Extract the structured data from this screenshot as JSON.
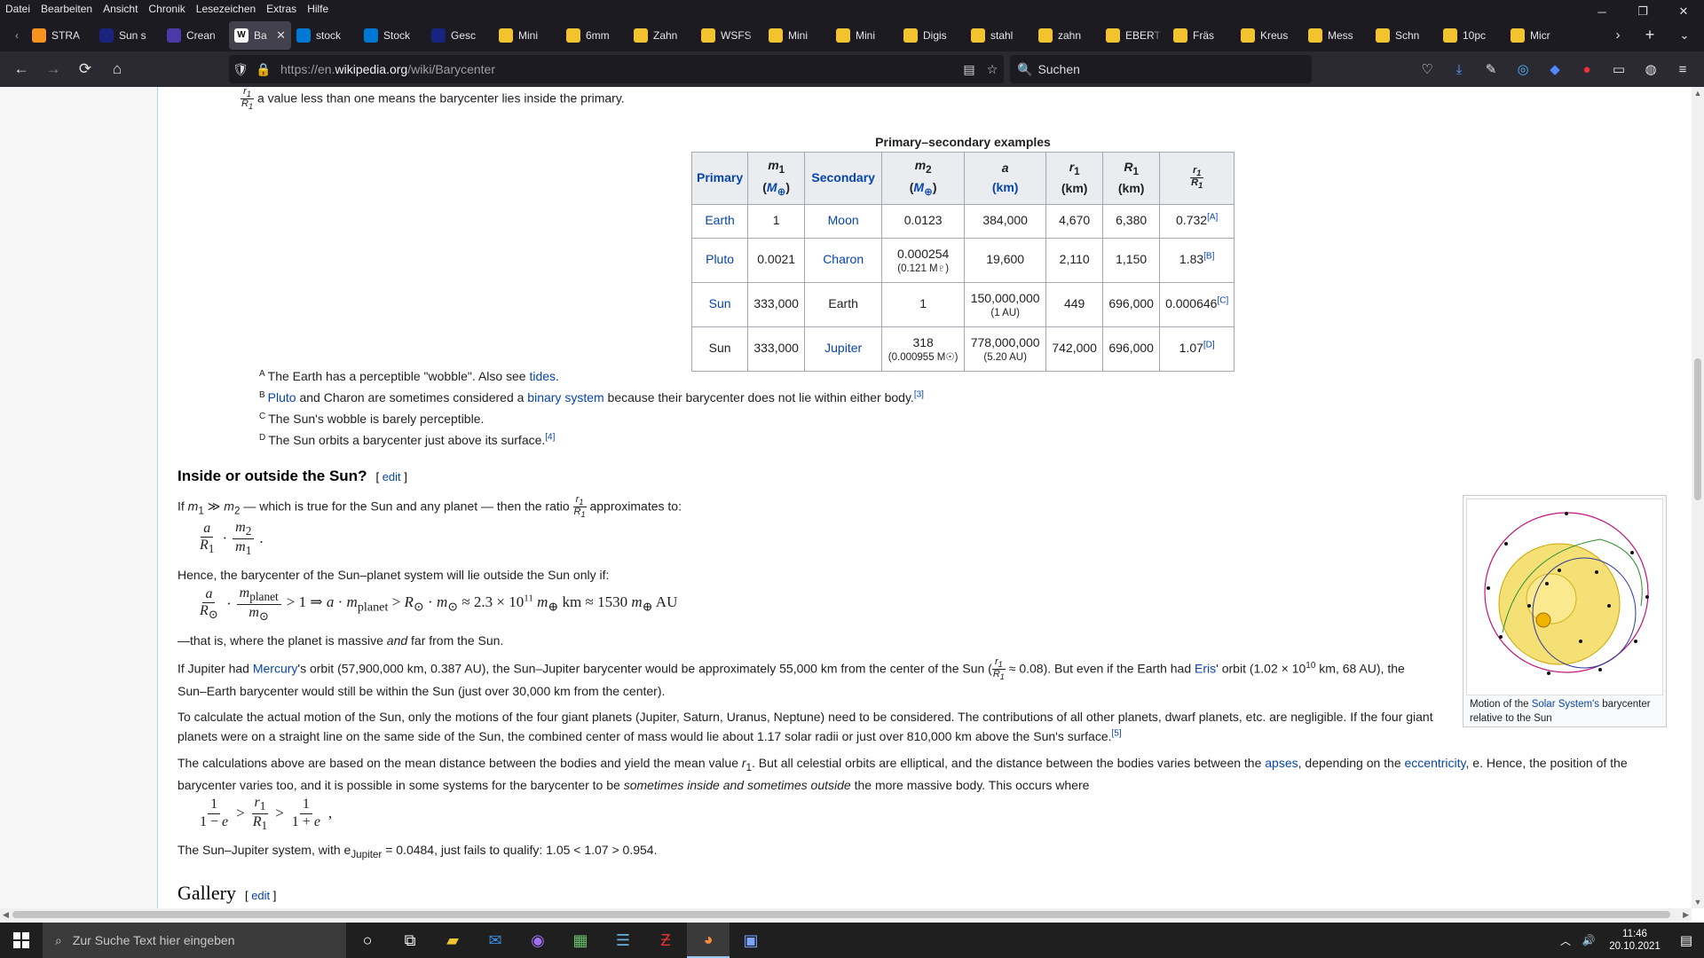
{
  "menubar": [
    "Datei",
    "Bearbeiten",
    "Ansicht",
    "Chronik",
    "Lesezeichen",
    "Extras",
    "Hilfe"
  ],
  "tabs": [
    {
      "label": "STRA",
      "color": "#f7931e",
      "active": false
    },
    {
      "label": "Sun s",
      "color": "#1a237e",
      "active": false
    },
    {
      "label": "Crean",
      "color": "#4a3aa8",
      "active": false
    },
    {
      "label": "Ba",
      "color": "#ffffff",
      "active": true,
      "glyph": "W"
    },
    {
      "label": "stock",
      "color": "#0078d4",
      "active": false
    },
    {
      "label": "Stock",
      "color": "#0078d4",
      "active": false
    },
    {
      "label": "Gesc",
      "color": "#1a237e",
      "active": false
    },
    {
      "label": "Mini",
      "color": "#f4c430",
      "active": false
    },
    {
      "label": "6mm",
      "color": "#f4c430",
      "active": false
    },
    {
      "label": "Zahn",
      "color": "#f4c430",
      "active": false
    },
    {
      "label": "WSFS",
      "color": "#f4c430",
      "active": false
    },
    {
      "label": "Mini",
      "color": "#f4c430",
      "active": false
    },
    {
      "label": "Mini",
      "color": "#f4c430",
      "active": false
    },
    {
      "label": "Digis",
      "color": "#f4c430",
      "active": false
    },
    {
      "label": "stahl",
      "color": "#f4c430",
      "active": false
    },
    {
      "label": "zahn",
      "color": "#f4c430",
      "active": false
    },
    {
      "label": "EBERT",
      "color": "#f4c430",
      "active": false
    },
    {
      "label": "Fräs",
      "color": "#f4c430",
      "active": false
    },
    {
      "label": "Kreus",
      "color": "#f4c430",
      "active": false
    },
    {
      "label": "Mess",
      "color": "#f4c430",
      "active": false
    },
    {
      "label": "Schn",
      "color": "#f4c430",
      "active": false
    },
    {
      "label": "10pc",
      "color": "#f4c430",
      "active": false
    },
    {
      "label": "Micr",
      "color": "#f4c430",
      "active": false
    }
  ],
  "nav": {
    "url_prefix": "https://en.",
    "url_domain": "wikipedia.org",
    "url_path": "/wiki/Barycenter",
    "search_placeholder": "Suchen"
  },
  "page": {
    "top_line": "a value less than one means the barycenter lies inside the primary.",
    "table_caption": "Primary–secondary examples",
    "table_headers": [
      "Primary",
      "m1 (M⊕)",
      "Secondary",
      "m2 (M⊕)",
      "a (km)",
      "r1 (km)",
      "R1 (km)",
      "r1/R1"
    ],
    "rows": [
      {
        "primary": "Earth",
        "m1": "1",
        "secondary": "Moon",
        "m2": "0.0123",
        "m2_sub": "",
        "a": "384,000",
        "a_sub": "",
        "r1": "4,670",
        "R1": "6,380",
        "ratio": "0.732",
        "note": "[A]"
      },
      {
        "primary": "Pluto",
        "m1": "0.0021",
        "secondary": "Charon",
        "m2": "0.000254",
        "m2_sub": "(0.121 M♇)",
        "a": "19,600",
        "a_sub": "",
        "r1": "2,110",
        "R1": "1,150",
        "ratio": "1.83",
        "note": "[B]"
      },
      {
        "primary": "Sun",
        "m1": "333,000",
        "secondary": "Earth",
        "m2": "1",
        "m2_sub": "",
        "a": "150,000,000",
        "a_sub": "(1 AU)",
        "r1": "449",
        "R1": "696,000",
        "ratio": "0.000646",
        "note": "[C]"
      },
      {
        "primary": "Sun",
        "m1": "333,000",
        "secondary": "Jupiter",
        "m2": "318",
        "m2_sub": "(0.000955 M☉)",
        "a": "778,000,000",
        "a_sub": "(5.20 AU)",
        "r1": "742,000",
        "R1": "696,000",
        "ratio": "1.07",
        "note": "[D]"
      }
    ],
    "footnotes": [
      {
        "mark": "A",
        "text": "The Earth has a perceptible \"wobble\". Also see ",
        "link": "tides",
        "after": "."
      },
      {
        "mark": "B",
        "link_first": "Pluto",
        "text": " and Charon are sometimes considered a ",
        "link": "binary system",
        "after": " because their barycenter does not lie within either body.",
        "ref": "[3]"
      },
      {
        "mark": "C",
        "text": "The Sun's wobble is barely perceptible.",
        "link": "",
        "after": ""
      },
      {
        "mark": "D",
        "text": "The Sun orbits a barycenter just above its surface.",
        "link": "",
        "after": "",
        "ref": "[4]"
      }
    ],
    "section1_title": "Inside or outside the Sun?",
    "edit_label": "edit",
    "p1": "— which is true for the Sun and any planet — then the ratio",
    "p1_end": "approximates to:",
    "p2": "Hence, the barycenter of the Sun–planet system will lie outside the Sun only if:",
    "p3a": "—that is, where the planet is massive ",
    "p3b": "and",
    "p3c": " far from the Sun.",
    "p4": {
      "a": "If Jupiter had ",
      "link1": "Mercury",
      "b": "'s orbit (57,900,000 km, 0.387 AU), the Sun–Jupiter barycenter would be approximately 55,000 km from the center of the Sun (",
      "c": " ≈ 0.08). But even if the Earth had ",
      "link2": "Eris",
      "d": "' orbit (1.02 × 10",
      "exp": "10",
      "e": " km, 68 AU), the Sun–Earth barycenter would still be within the Sun (just over 30,000 km from the center)."
    },
    "p5": "To calculate the actual motion of the Sun, only the motions of the four giant planets (Jupiter, Saturn, Uranus, Neptune) need to be considered. The contributions of all other planets, dwarf planets, etc. are negligible. If the four giant planets were on a straight line on the same side of the Sun, the combined center of mass would lie about 1.17 solar radii or just over 810,000 km above the Sun's surface.",
    "p5_ref": "[5]",
    "p6": {
      "a": "The calculations above are based on the mean distance between the bodies and yield the mean value ",
      "b": ". But all celestial orbits are elliptical, and the distance between the bodies varies between the ",
      "link1": "apses",
      "c": ", depending on the ",
      "link2": "eccentricity",
      "d": ", e. Hence, the position of the barycenter varies too, and it is possible in some systems for the barycenter to be ",
      "em": "sometimes inside and sometimes outside",
      "e": " the more massive body. This occurs where"
    },
    "p7": "The Sun–Jupiter system, with e",
    "p7_sub": "Jupiter",
    "p7_end": " = 0.0484, just fails to qualify: 1.05 < 1.07 > 0.954.",
    "section2_title": "Gallery",
    "thumb_caption_a": "Motion of the ",
    "thumb_caption_link": "Solar System's",
    "thumb_caption_b": " barycenter relative to the Sun"
  },
  "taskbar": {
    "search_placeholder": "Zur Suche Text hier eingeben",
    "time": "11:46",
    "date": "20.10.2021"
  }
}
